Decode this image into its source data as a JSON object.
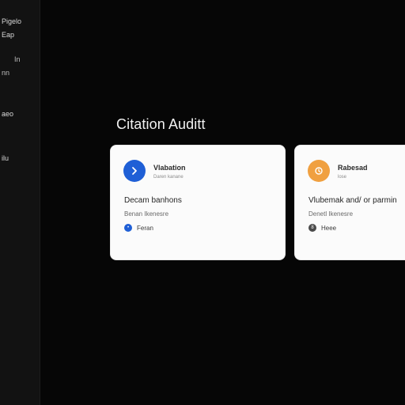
{
  "sidebar": {
    "items": [
      {
        "label": "Pigelo"
      },
      {
        "label": "Eap"
      },
      {
        "label": "In"
      },
      {
        "label": "nn"
      },
      {
        "label": "aeo"
      },
      {
        "label": "ilu"
      }
    ]
  },
  "main": {
    "title": "Citation Auditt",
    "cards": [
      {
        "name": "Vlabation",
        "subtitle": "Daren kanane",
        "heading": "Decam banhons",
        "meta": "Benan Ikenesre",
        "chip_label": "Feran",
        "accent": "#1f5fd6",
        "avatar_icon": "chevron-right-icon"
      },
      {
        "name": "Rabesad",
        "subtitle": "lose",
        "heading": "Vlubemak and/ or parmin",
        "meta": "Denetl Ikenesre",
        "chip_label": "Heee",
        "chip_glyph": "8",
        "accent": "#f0a040",
        "avatar_icon": "clock-icon"
      }
    ]
  }
}
